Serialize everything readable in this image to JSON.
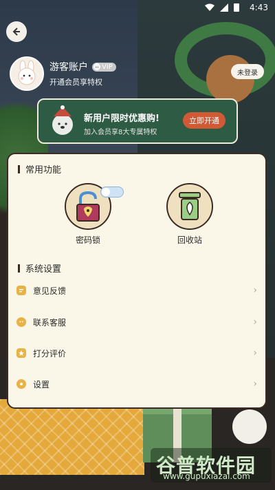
{
  "status_bar": {
    "time": "4:43"
  },
  "profile": {
    "name": "游客账户",
    "vip_badge": "VIP",
    "subtitle": "开通会员享特权",
    "login_button": "未登录"
  },
  "promo": {
    "title": "新用户限时优惠购!",
    "subtitle": "加入会员享8大专属特权",
    "button": "立即开通"
  },
  "common": {
    "section_title": "常用功能",
    "items": [
      {
        "label": "密码锁",
        "icon": "padlock-icon"
      },
      {
        "label": "回收站",
        "icon": "trash-bin-icon"
      }
    ]
  },
  "settings": {
    "section_title": "系统设置",
    "items": [
      {
        "label": "意见反馈",
        "icon": "feedback-icon"
      },
      {
        "label": "联系客服",
        "icon": "customer-service-icon"
      },
      {
        "label": "打分评价",
        "icon": "rate-icon"
      },
      {
        "label": "设置",
        "icon": "settings-icon"
      }
    ]
  },
  "watermark": {
    "text": "谷普软件园",
    "url": "www.gupuxiazai.com"
  },
  "colors": {
    "panel": "#fbf7e8",
    "promo": "#2d5b43",
    "promo_button": "#d05a36",
    "accent": "#e7b347"
  }
}
